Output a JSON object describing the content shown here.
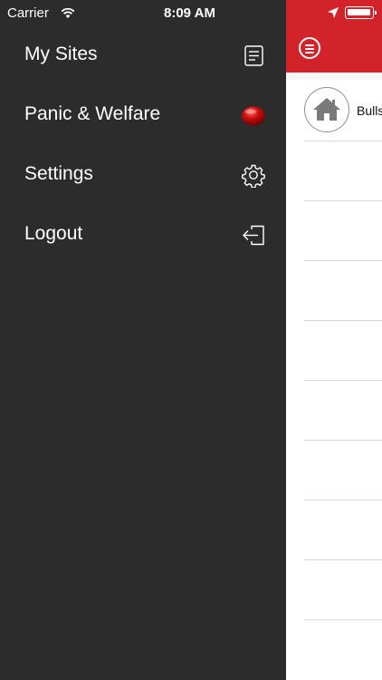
{
  "status_bar": {
    "carrier": "Carrier",
    "time": "8:09 AM",
    "icons": [
      "wifi-icon",
      "location-arrow-icon",
      "battery-icon"
    ]
  },
  "drawer": {
    "background": "#2c2c2c",
    "items": [
      {
        "label": "My Sites",
        "icon": "list-document-icon"
      },
      {
        "label": "Panic & Welfare",
        "icon": "red-panic-button-icon"
      },
      {
        "label": "Settings",
        "icon": "gear-icon"
      },
      {
        "label": "Logout",
        "icon": "logout-icon"
      }
    ]
  },
  "main": {
    "header_color": "#d2232a",
    "menu_icon": "hamburger-menu-icon",
    "sites": [
      {
        "name": "Bulls",
        "icon": "home-icon"
      }
    ]
  }
}
